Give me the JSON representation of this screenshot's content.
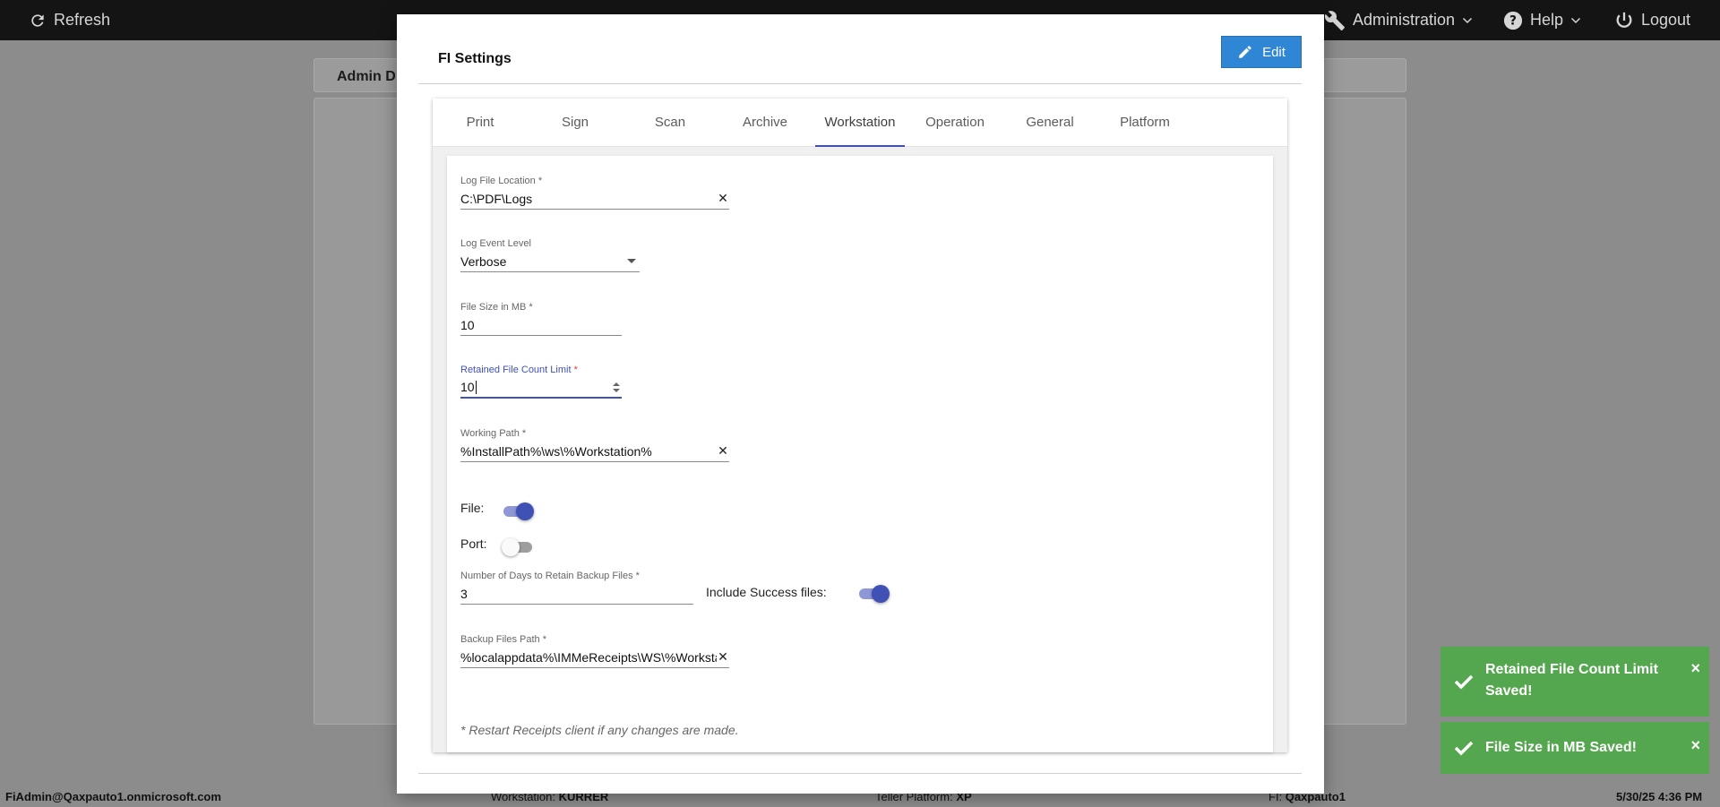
{
  "topbar": {
    "refresh_label": "Refresh",
    "administration_label": "Administration",
    "help_label": "Help",
    "logout_label": "Logout"
  },
  "background": {
    "panel_title": "Admin D"
  },
  "modal": {
    "title": "FI Settings",
    "edit_label": "Edit",
    "tabs": [
      {
        "label": "Print"
      },
      {
        "label": "Sign"
      },
      {
        "label": "Scan"
      },
      {
        "label": "Archive"
      },
      {
        "label": "Workstation"
      },
      {
        "label": "Operation"
      },
      {
        "label": "General"
      },
      {
        "label": "Platform"
      }
    ],
    "active_tab": "Workstation",
    "fields": {
      "log_file_location": {
        "label": "Log File Location",
        "value": "C:\\PDF\\Logs"
      },
      "log_event_level": {
        "label": "Log Event Level",
        "value": "Verbose"
      },
      "file_size_mb": {
        "label": "File Size in MB",
        "value": "10"
      },
      "retained_file_count": {
        "label": "Retained File Count Limit",
        "value": "10"
      },
      "working_path": {
        "label": "Working Path",
        "value": "%InstallPath%\\ws\\%Workstation%"
      },
      "backup_days": {
        "label": "Number of Days to Retain Backup Files",
        "value": "3"
      },
      "backup_path": {
        "label": "Backup Files Path",
        "value": "%localappdata%\\IMMeReceipts\\WS\\%Workstation%"
      }
    },
    "required_mark": "*",
    "toggles": {
      "file": {
        "label": "File:",
        "on": true
      },
      "port": {
        "label": "Port:",
        "on": false
      },
      "include_success": {
        "label": "Include Success files:",
        "on": true
      }
    },
    "note": "* Restart Receipts client if any changes are made."
  },
  "toasts": [
    {
      "line1": "Retained File Count Limit",
      "line2": "Saved!",
      "close": "×"
    },
    {
      "line1": "File Size in MB Saved!",
      "close": "×"
    }
  ],
  "statusbar": {
    "user": "FiAdmin@Qaxpauto1.onmicrosoft.com",
    "workstation_label": "Workstation:",
    "workstation_value": "KURRER",
    "teller_label": "Teller Platform:",
    "teller_value": "XP",
    "fi_label": "FI:",
    "fi_value": "Qaxpauto1",
    "datetime": "5/30/25 4:36 PM"
  },
  "colors": {
    "accent": "#3f51b5",
    "edit_button": "#2f86d5",
    "toast_success": "#55a74f",
    "topbar": "#141414"
  }
}
